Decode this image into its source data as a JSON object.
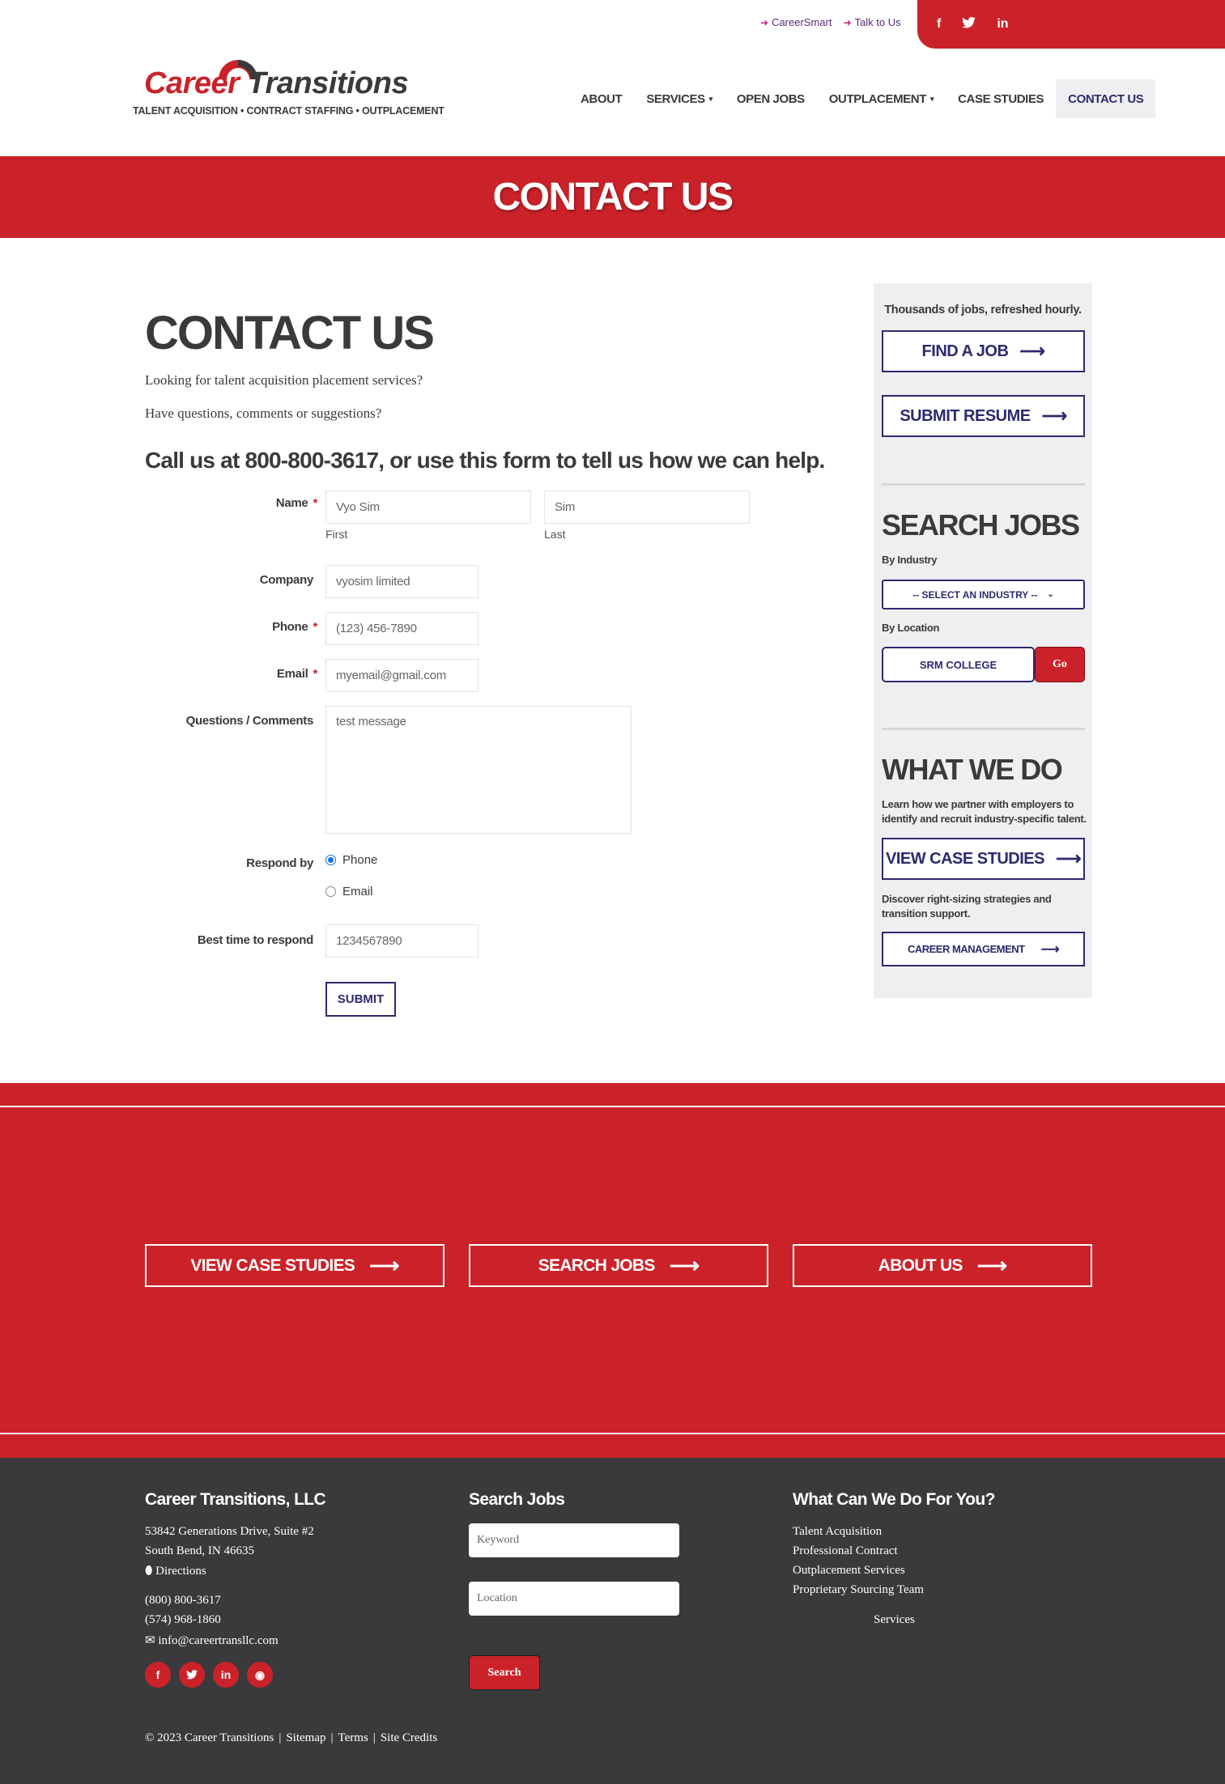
{
  "colors": {
    "brand_red": "#cb2229",
    "navy": "#2d2a6e",
    "dark_gray": "#3a3a3c",
    "sidebar_bg": "#efeff1"
  },
  "utility": {
    "links": [
      {
        "icon": "sign-in-icon",
        "label": "CareerSmart"
      },
      {
        "icon": "sign-in-icon",
        "label": "Talk to Us"
      }
    ],
    "social": [
      {
        "icon": "facebook-icon",
        "glyph": "f"
      },
      {
        "icon": "twitter-icon",
        "glyph": "t"
      },
      {
        "icon": "linkedin-icon",
        "glyph": "in"
      }
    ]
  },
  "logo": {
    "word1": "Career",
    "word2": "Transitions",
    "tagline": "TALENT ACQUISITION • CONTRACT STAFFING • OUTPLACEMENT"
  },
  "nav": [
    {
      "label": "ABOUT",
      "caret": ""
    },
    {
      "label": "SERVICES",
      "caret": "▾"
    },
    {
      "label": "OPEN JOBS",
      "caret": ""
    },
    {
      "label": "OUTPLACEMENT",
      "caret": "▾"
    },
    {
      "label": "CASE STUDIES",
      "caret": ""
    },
    {
      "label": "CONTACT US",
      "caret": "",
      "active": true
    }
  ],
  "banner": {
    "title": "CONTACT US"
  },
  "main": {
    "title": "CONTACT US",
    "intro1": "Looking for talent acquisition placement services?",
    "intro2": "Have questions, comments or suggestions?",
    "callus": "Call us at 800-800-3617, or use this form to tell us how we can help."
  },
  "form": {
    "name_label": "Name",
    "first_value": "Vyo Sim",
    "first_sub": "First",
    "last_value": "Sim",
    "last_sub": "Last",
    "company_label": "Company",
    "company_value": "vyosim limited",
    "phone_label": "Phone",
    "phone_value": "(123) 456-7890",
    "email_label": "Email",
    "email_value": "myemail@gmail.com",
    "comments_label": "Questions / Comments",
    "comments_value": "test message",
    "respond_label": "Respond by",
    "respond_options": [
      "Phone",
      "Email"
    ],
    "respond_selected": "Phone",
    "best_time_label": "Best time to respond",
    "best_time_value": "1234567890",
    "required_mark": "*",
    "submit_label": "SUBMIT"
  },
  "sidebar": {
    "tagline": "Thousands of jobs, refreshed hourly.",
    "find_job": "FIND A JOB",
    "submit_resume": "SUBMIT RESUME",
    "search_heading": "SEARCH JOBS",
    "by_industry": "By Industry",
    "industry_select": "-- SELECT AN INDUSTRY --",
    "by_location": "By Location",
    "location_value": "SRM COLLEGE",
    "go_label": "Go",
    "what_heading": "WHAT WE DO",
    "what_text": "Learn how we partner with employers to identify and recruit industry-specific talent.",
    "view_case_studies": "VIEW CASE STUDIES",
    "discover_text": "Discover right-sizing strategies and transition support.",
    "career_management": "CAREER MANAGEMENT",
    "arrow": "⟶"
  },
  "cta": {
    "buttons": [
      "VIEW CASE STUDIES",
      "SEARCH JOBS",
      "ABOUT US"
    ],
    "arrow": "⟶"
  },
  "footer": {
    "company": {
      "heading": "Career Transitions, LLC",
      "address1": "53842 Generations Drive, Suite #2",
      "address2": "South Bend, IN 46635",
      "directions": "Directions",
      "phone1": "(800) 800-3617",
      "phone2": "(574) 968-1860",
      "email": "info@careertransllc.com"
    },
    "search": {
      "heading": "Search Jobs",
      "keyword_placeholder": "Keyword",
      "location_placeholder": "Location",
      "button": "Search"
    },
    "services": {
      "heading": "What Can We Do For You?",
      "items": [
        "Talent Acquisition",
        "Professional Contract",
        "Outplacement Services",
        "Proprietary Sourcing Team"
      ],
      "link": "Services"
    },
    "social": [
      {
        "icon": "facebook-icon",
        "glyph": "f"
      },
      {
        "icon": "twitter-icon",
        "glyph": "t"
      },
      {
        "icon": "linkedin-icon",
        "glyph": "in"
      },
      {
        "icon": "rss-icon",
        "glyph": "◉"
      }
    ],
    "bottom": [
      "© 2023 Career Transitions",
      "|",
      "Sitemap",
      "|",
      "Terms",
      "|",
      "Site Credits"
    ]
  }
}
